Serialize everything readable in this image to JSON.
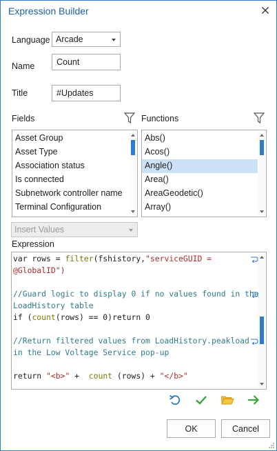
{
  "window": {
    "title": "Expression Builder"
  },
  "language": {
    "label": "Language",
    "value": "Arcade"
  },
  "name": {
    "label": "Name",
    "value": "Count"
  },
  "title_field": {
    "label": "Title",
    "value": "#Updates"
  },
  "fields": {
    "label": "Fields",
    "items": [
      "Asset Group",
      "Asset Type",
      "Association status",
      "Is connected",
      "Subnetwork controller name",
      "Terminal Configuration"
    ]
  },
  "functions": {
    "label": "Functions",
    "items": [
      "Abs()",
      "Acos()",
      "Angle()",
      "Area()",
      "AreaGeodetic()",
      "Array()"
    ],
    "selected": "Angle()"
  },
  "insert_values": {
    "label": "Insert Values"
  },
  "expression": {
    "label": "Expression",
    "lines": [
      "var rows = filter(fshistory,\"serviceGUID =",
      "@GlobalID\")",
      "",
      "//Guard logic to display 0 if no values found in the",
      "LoadHistory table",
      "if (count(rows) == 0)return 0",
      "",
      "//Return filtered values from LoadHistory.peakload",
      "in the Low Voltage Service pop-up",
      "",
      "return \"<b>\" +  count (rows) + \"</b>\""
    ]
  },
  "buttons": {
    "ok": "OK",
    "cancel": "Cancel"
  },
  "colors": {
    "accent": "#2b7bd0",
    "title": "#1a62b0",
    "selection": "#cce1f5",
    "check": "#3aa33a",
    "folder": "#e2a420",
    "arrow": "#3aa33a"
  }
}
